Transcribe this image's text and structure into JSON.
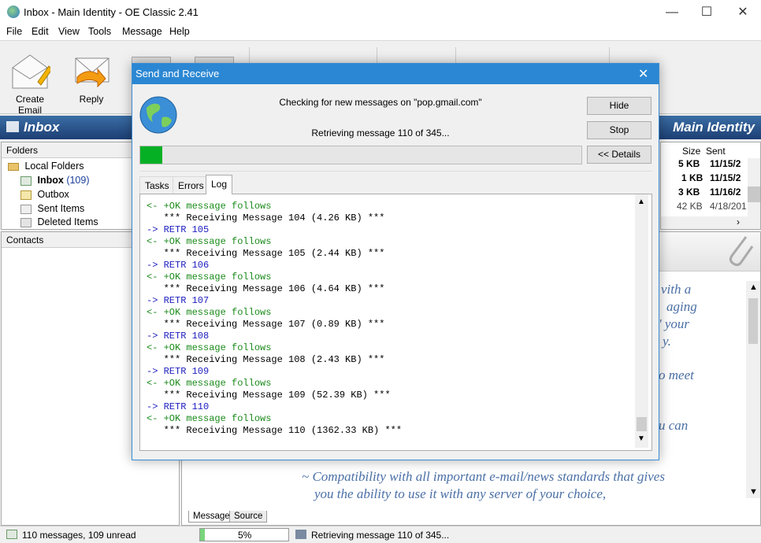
{
  "window": {
    "title": "Inbox - Main Identity - OE Classic 2.41"
  },
  "menu": [
    "File",
    "Edit",
    "View",
    "Tools",
    "Message",
    "Help"
  ],
  "toolbar": {
    "create_email": "Create Email",
    "reply": "Reply"
  },
  "banner": {
    "folder": "Inbox",
    "identity": "Main Identity"
  },
  "folders": {
    "header": "Folders",
    "root": "Local Folders",
    "items": [
      {
        "name": "Inbox",
        "count": "(109)"
      },
      {
        "name": "Outbox",
        "count": ""
      },
      {
        "name": "Sent Items",
        "count": ""
      },
      {
        "name": "Deleted Items",
        "count": ""
      }
    ]
  },
  "contacts": {
    "header": "Contacts"
  },
  "message_list": {
    "columns": [
      "Size",
      "Sent"
    ],
    "rows": [
      {
        "size": "5 KB",
        "sent": "11/15/2"
      },
      {
        "size": "1 KB",
        "sent": "11/15/2"
      },
      {
        "size": "3 KB",
        "sent": "11/16/2"
      },
      {
        "size": "42 KB",
        "sent": "4/18/201"
      }
    ]
  },
  "preview": {
    "fragments": [
      "vith a",
      "aging",
      "' your",
      "y.",
      "o meet",
      "u can"
    ],
    "line1": "~ Compatibility with all important e-mail/news standards that gives",
    "line2": "you the ability to use it with any server of your choice,",
    "tabs": [
      "Message",
      "Source"
    ]
  },
  "statusbar": {
    "messages": "110 messages, 109 unread",
    "percent": "5%",
    "status": "Retrieving message 110 of 345..."
  },
  "dialog": {
    "title": "Send and Receive",
    "checking": "Checking for new messages on \"pop.gmail.com\"",
    "retrieving": "Retrieving message 110 of 345...",
    "progress": 0.05,
    "buttons": {
      "hide": "Hide",
      "stop": "Stop",
      "details": "<< Details"
    },
    "tabs": [
      "Tasks",
      "Errors",
      "Log"
    ],
    "log": [
      {
        "t": "in",
        "text": "<- +OK message follows"
      },
      {
        "t": "info",
        "text": "   *** Receiving Message 104 (4.26 KB) ***"
      },
      {
        "t": "out",
        "text": "-> RETR 105"
      },
      {
        "t": "in",
        "text": "<- +OK message follows"
      },
      {
        "t": "info",
        "text": "   *** Receiving Message 105 (2.44 KB) ***"
      },
      {
        "t": "out",
        "text": "-> RETR 106"
      },
      {
        "t": "in",
        "text": "<- +OK message follows"
      },
      {
        "t": "info",
        "text": "   *** Receiving Message 106 (4.64 KB) ***"
      },
      {
        "t": "out",
        "text": "-> RETR 107"
      },
      {
        "t": "in",
        "text": "<- +OK message follows"
      },
      {
        "t": "info",
        "text": "   *** Receiving Message 107 (0.89 KB) ***"
      },
      {
        "t": "out",
        "text": "-> RETR 108"
      },
      {
        "t": "in",
        "text": "<- +OK message follows"
      },
      {
        "t": "info",
        "text": "   *** Receiving Message 108 (2.43 KB) ***"
      },
      {
        "t": "out",
        "text": "-> RETR 109"
      },
      {
        "t": "in",
        "text": "<- +OK message follows"
      },
      {
        "t": "info",
        "text": "   *** Receiving Message 109 (52.39 KB) ***"
      },
      {
        "t": "out",
        "text": "-> RETR 110"
      },
      {
        "t": "in",
        "text": "<- +OK message follows"
      },
      {
        "t": "info",
        "text": "   *** Receiving Message 110 (1362.33 KB) ***"
      }
    ]
  }
}
